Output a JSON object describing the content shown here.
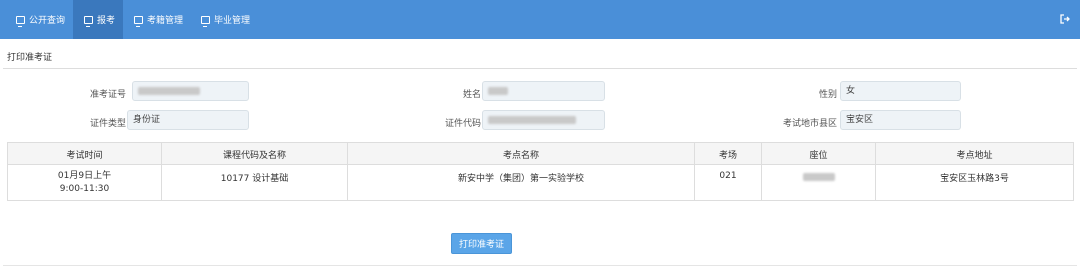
{
  "nav": {
    "items": [
      {
        "label": "公开查询",
        "icon": "monitor-icon",
        "active": false
      },
      {
        "label": "报考",
        "icon": "monitor-icon",
        "active": true
      },
      {
        "label": "考籍管理",
        "icon": "monitor-icon",
        "active": false
      },
      {
        "label": "毕业管理",
        "icon": "monitor-icon",
        "active": false
      }
    ],
    "logout_icon": "logout-icon"
  },
  "section": {
    "title": "打印准考证"
  },
  "form": {
    "exam_no_label": "准考证号",
    "name_label": "姓名",
    "gender_label": "性别",
    "gender_value": "女",
    "id_type_label": "证件类型",
    "id_type_value": "身份证",
    "id_code_label": "证件代码",
    "district_label": "考试地市县区",
    "district_value": "宝安区"
  },
  "table": {
    "headers": [
      "考试时间",
      "课程代码及名称",
      "考点名称",
      "考场",
      "座位",
      "考点地址"
    ],
    "row": {
      "time_line1": "01月9日上午",
      "time_line2": "9:00-11:30",
      "course": "10177 设计基础",
      "site": "新安中学（集团）第一实验学校",
      "room": "021",
      "address": "宝安区玉林路3号"
    }
  },
  "actions": {
    "print_label": "打印准考证"
  },
  "colors": {
    "navbar": "#4a8fd8",
    "nav_active": "#3a78bd",
    "button": "#5aa5e8"
  }
}
